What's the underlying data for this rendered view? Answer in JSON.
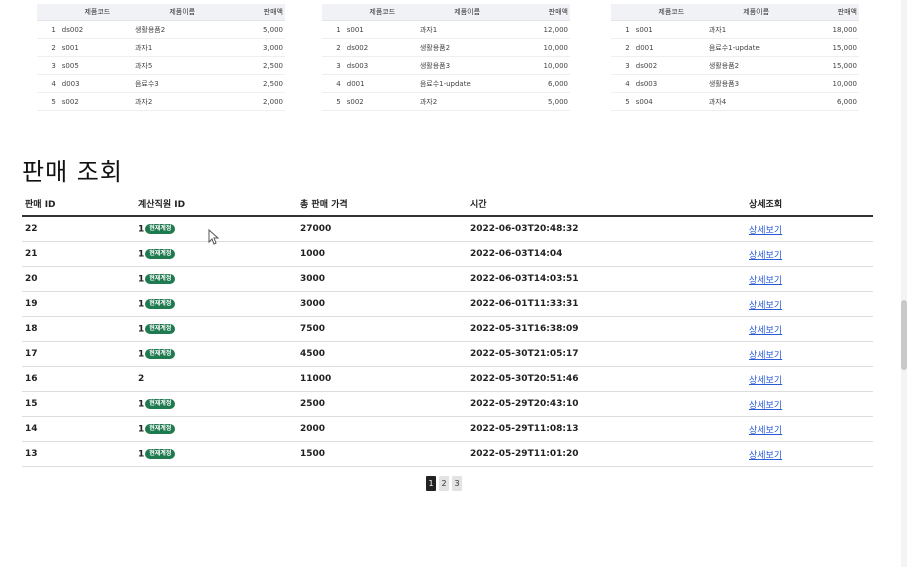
{
  "rank_headers": {
    "code": "제품코드",
    "name": "제품이름",
    "amount": "판매액"
  },
  "rank_tables": [
    {
      "rows": [
        {
          "rank": "1",
          "code": "ds002",
          "name": "생활용품2",
          "amount": "5,000"
        },
        {
          "rank": "2",
          "code": "s001",
          "name": "과자1",
          "amount": "3,000"
        },
        {
          "rank": "3",
          "code": "s005",
          "name": "과자5",
          "amount": "2,500"
        },
        {
          "rank": "4",
          "code": "d003",
          "name": "음료수3",
          "amount": "2,500"
        },
        {
          "rank": "5",
          "code": "s002",
          "name": "과자2",
          "amount": "2,000"
        }
      ]
    },
    {
      "rows": [
        {
          "rank": "1",
          "code": "s001",
          "name": "과자1",
          "amount": "12,000"
        },
        {
          "rank": "2",
          "code": "ds002",
          "name": "생활용품2",
          "amount": "10,000"
        },
        {
          "rank": "3",
          "code": "ds003",
          "name": "생활용품3",
          "amount": "10,000"
        },
        {
          "rank": "4",
          "code": "d001",
          "name": "음료수1-update",
          "amount": "6,000"
        },
        {
          "rank": "5",
          "code": "s002",
          "name": "과자2",
          "amount": "5,000"
        }
      ]
    },
    {
      "rows": [
        {
          "rank": "1",
          "code": "s001",
          "name": "과자1",
          "amount": "18,000"
        },
        {
          "rank": "2",
          "code": "d001",
          "name": "음료수1-update",
          "amount": "15,000"
        },
        {
          "rank": "3",
          "code": "ds002",
          "name": "생활용품2",
          "amount": "15,000"
        },
        {
          "rank": "4",
          "code": "ds003",
          "name": "생활용품3",
          "amount": "10,000"
        },
        {
          "rank": "5",
          "code": "s004",
          "name": "과자4",
          "amount": "6,000"
        }
      ]
    }
  ],
  "page_title": "판매 조회",
  "sales_headers": {
    "id": "판매 ID",
    "cashier": "계산직원 ID",
    "total": "총 판매 가격",
    "time": "시간",
    "detail": "상세조회"
  },
  "badge_label": "현재계정",
  "detail_label": "상세보기",
  "sales_rows": [
    {
      "id": "22",
      "cashier": "1",
      "current": true,
      "total": "27000",
      "time": "2022-06-03T20:48:32"
    },
    {
      "id": "21",
      "cashier": "1",
      "current": true,
      "total": "1000",
      "time": "2022-06-03T14:04"
    },
    {
      "id": "20",
      "cashier": "1",
      "current": true,
      "total": "3000",
      "time": "2022-06-03T14:03:51"
    },
    {
      "id": "19",
      "cashier": "1",
      "current": true,
      "total": "3000",
      "time": "2022-06-01T11:33:31"
    },
    {
      "id": "18",
      "cashier": "1",
      "current": true,
      "total": "7500",
      "time": "2022-05-31T16:38:09"
    },
    {
      "id": "17",
      "cashier": "1",
      "current": true,
      "total": "4500",
      "time": "2022-05-30T21:05:17"
    },
    {
      "id": "16",
      "cashier": "2",
      "current": false,
      "total": "11000",
      "time": "2022-05-30T20:51:46"
    },
    {
      "id": "15",
      "cashier": "1",
      "current": true,
      "total": "2500",
      "time": "2022-05-29T20:43:10"
    },
    {
      "id": "14",
      "cashier": "1",
      "current": true,
      "total": "2000",
      "time": "2022-05-29T11:08:13"
    },
    {
      "id": "13",
      "cashier": "1",
      "current": true,
      "total": "1500",
      "time": "2022-05-29T11:01:20"
    }
  ],
  "pagination": {
    "pages": [
      "1",
      "2",
      "3"
    ],
    "active_index": 0
  },
  "colors": {
    "badge": "#1f7a4f",
    "link": "#2a5bd7",
    "active_page": "#222222"
  }
}
